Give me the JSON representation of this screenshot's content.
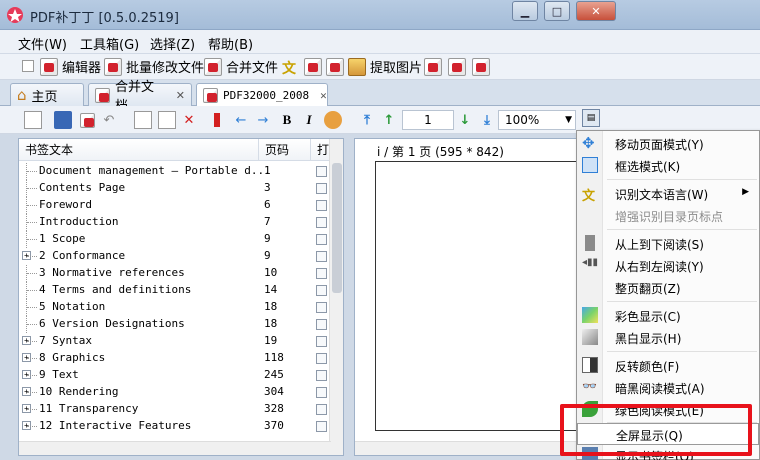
{
  "window": {
    "title": "PDF补丁丁 [0.5.0.2519]"
  },
  "menubar": {
    "file": "文件(W)",
    "toolbox": "工具箱(G)",
    "select": "选择(Z)",
    "help": "帮助(B)"
  },
  "toolbar": {
    "editor": "编辑器",
    "batch": "批量修改文件",
    "merge": "合并文件",
    "extract": "提取图片"
  },
  "tabs": [
    {
      "label": "主页"
    },
    {
      "label": "合并文档"
    },
    {
      "label": "PDF32000_2008"
    }
  ],
  "toolbar2": {
    "page_number": "1",
    "zoom": "100%"
  },
  "bookmarks": {
    "headers": {
      "text": "书签文本",
      "page": "页码",
      "open": "打开"
    },
    "items": [
      {
        "label": "Document management — Portable d...",
        "page": "1",
        "expandable": false
      },
      {
        "label": "Contents Page",
        "page": "3",
        "expandable": false
      },
      {
        "label": "Foreword",
        "page": "6",
        "expandable": false
      },
      {
        "label": "Introduction",
        "page": "7",
        "expandable": false
      },
      {
        "label": "1 Scope",
        "page": "9",
        "expandable": false
      },
      {
        "label": "2 Conformance",
        "page": "9",
        "expandable": true
      },
      {
        "label": "3 Normative references",
        "page": "10",
        "expandable": false
      },
      {
        "label": "4 Terms and definitions",
        "page": "14",
        "expandable": false
      },
      {
        "label": "5 Notation",
        "page": "18",
        "expandable": false
      },
      {
        "label": "6 Version Designations",
        "page": "18",
        "expandable": false
      },
      {
        "label": "7 Syntax",
        "page": "19",
        "expandable": true
      },
      {
        "label": "8 Graphics",
        "page": "118",
        "expandable": true
      },
      {
        "label": "9 Text",
        "page": "245",
        "expandable": true
      },
      {
        "label": "10 Rendering",
        "page": "304",
        "expandable": true
      },
      {
        "label": "11 Transparency",
        "page": "328",
        "expandable": true
      },
      {
        "label": "12 Interactive Features",
        "page": "370",
        "expandable": true
      }
    ]
  },
  "viewer": {
    "page_info": "i / 第 1 页 (595 * 842)"
  },
  "context_menu": {
    "items": [
      {
        "label": "移动页面模式(Y)"
      },
      {
        "label": "框选模式(K)"
      },
      {
        "label": "识别文本语言(W)"
      },
      {
        "label": "增强识别目录页标点"
      },
      {
        "label": "从上到下阅读(S)"
      },
      {
        "label": "从右到左阅读(Y)"
      },
      {
        "label": "整页翻页(Z)"
      },
      {
        "label": "彩色显示(C)"
      },
      {
        "label": "黑白显示(H)"
      },
      {
        "label": "反转颜色(F)"
      },
      {
        "label": "暗黑阅读模式(A)"
      },
      {
        "label": "绿色阅读模式(E)"
      },
      {
        "label": "全屏显示(Q)"
      },
      {
        "label": "显示书签栏(Q)"
      }
    ]
  },
  "colors": {
    "highlight_box": "#e8121b",
    "accent": "#2f7fd6"
  }
}
